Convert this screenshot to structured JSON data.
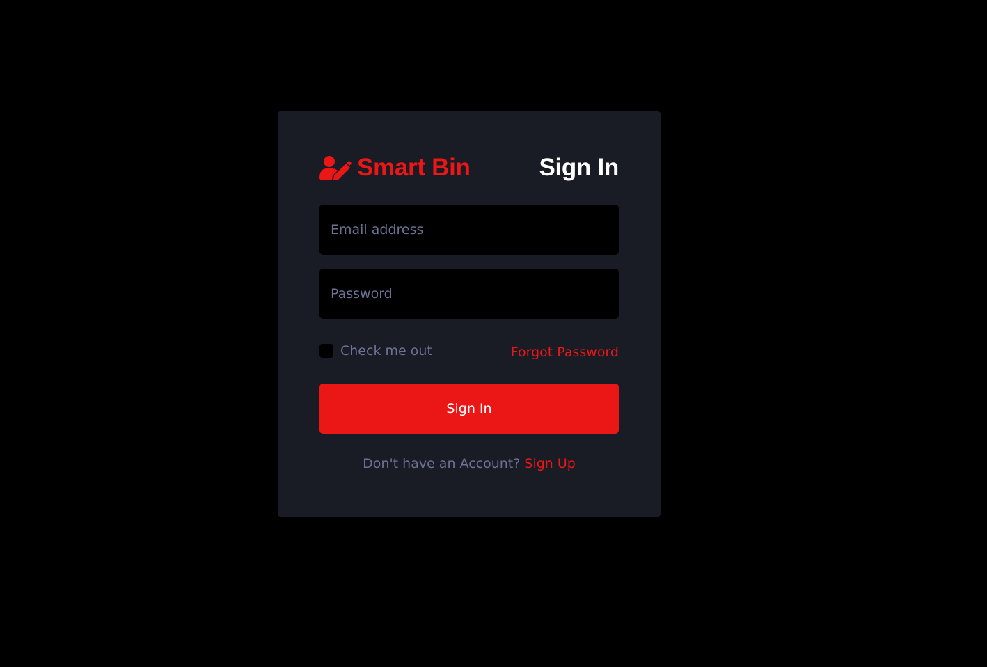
{
  "colors": {
    "page_background": "#000000",
    "card_background": "#191c24",
    "accent": "#eb1616",
    "muted_text": "#6c7293",
    "heading_text": "#ffffff",
    "input_background": "#000000"
  },
  "header": {
    "brand_icon": "user-edit-icon",
    "brand_name": "Smart Bin",
    "heading": "Sign In"
  },
  "form": {
    "email_placeholder": "Email address",
    "email_value": "",
    "password_placeholder": "Password",
    "password_value": "",
    "checkbox_label": "Check me out",
    "checkbox_checked": false,
    "forgot_password_label": "Forgot Password",
    "submit_label": "Sign In"
  },
  "footer": {
    "prompt_text": "Don't have an Account?",
    "signup_label": "Sign Up"
  }
}
